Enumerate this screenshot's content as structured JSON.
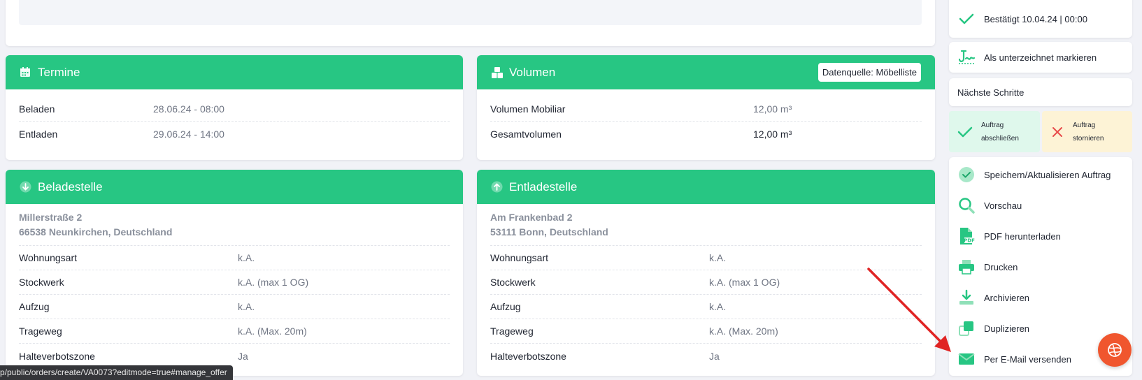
{
  "termine": {
    "title": "Termine",
    "rows": [
      {
        "label": "Beladen",
        "value": "28.06.24 - 08:00"
      },
      {
        "label": "Entladen",
        "value": "29.06.24 - 14:00"
      }
    ]
  },
  "volumen": {
    "title": "Volumen",
    "badge": "Datenquelle: Möbelliste",
    "rows": [
      {
        "label": "Volumen Mobiliar",
        "value": "12,00 m³"
      },
      {
        "label": "Gesamtvolumen",
        "value": "12,00 m³"
      }
    ]
  },
  "beladestelle": {
    "title": "Beladestelle",
    "street": "Millerstraße 2",
    "city": "66538 Neunkirchen, Deutschland",
    "rows": [
      {
        "label": "Wohnungsart",
        "value": "k.A."
      },
      {
        "label": "Stockwerk",
        "value": "k.A. (max 1 OG)"
      },
      {
        "label": "Aufzug",
        "value": "k.A."
      },
      {
        "label": "Trageweg",
        "value": "k.A. (Max. 20m)"
      },
      {
        "label": "Halteverbotszone",
        "value": "Ja"
      }
    ]
  },
  "entladestelle": {
    "title": "Entladestelle",
    "street": "Am Frankenbad 2",
    "city": "53111 Bonn, Deutschland",
    "rows": [
      {
        "label": "Wohnungsart",
        "value": "k.A."
      },
      {
        "label": "Stockwerk",
        "value": "k.A. (max 1 OG)"
      },
      {
        "label": "Aufzug",
        "value": "k.A."
      },
      {
        "label": "Trageweg",
        "value": "k.A. (Max. 20m)"
      },
      {
        "label": "Halteverbotszone",
        "value": "Ja"
      }
    ]
  },
  "sidebar": {
    "confirmed": "Bestätigt 10.04.24 | 00:00",
    "mark_signed": "Als unterzeichnet markieren",
    "next_steps": "Nächste Schritte",
    "complete_line1": "Auftrag",
    "complete_line2": "abschließen",
    "cancel_line1": "Auftrag",
    "cancel_line2": "stornieren",
    "actions": [
      {
        "label": "Speichern/Aktualisieren Auftrag",
        "icon": "check-circle-icon"
      },
      {
        "label": "Vorschau",
        "icon": "magnifier-icon"
      },
      {
        "label": "PDF herunterladen",
        "icon": "pdf-file-icon"
      },
      {
        "label": "Drucken",
        "icon": "printer-icon"
      },
      {
        "label": "Archivieren",
        "icon": "download-icon"
      },
      {
        "label": "Duplizieren",
        "icon": "duplicate-icon"
      },
      {
        "label": "Per E-Mail versenden",
        "icon": "envelope-icon"
      }
    ]
  },
  "status_url": "p/public/orders/create/VA0073?editmode=true#manage_offer",
  "colors": {
    "accent": "#27c683",
    "complete_bg": "#dff8ec",
    "cancel_bg": "#fdf3d6",
    "cancel_x": "#e84b4b",
    "fab": "#f0562e",
    "arrow": "#e02424"
  }
}
